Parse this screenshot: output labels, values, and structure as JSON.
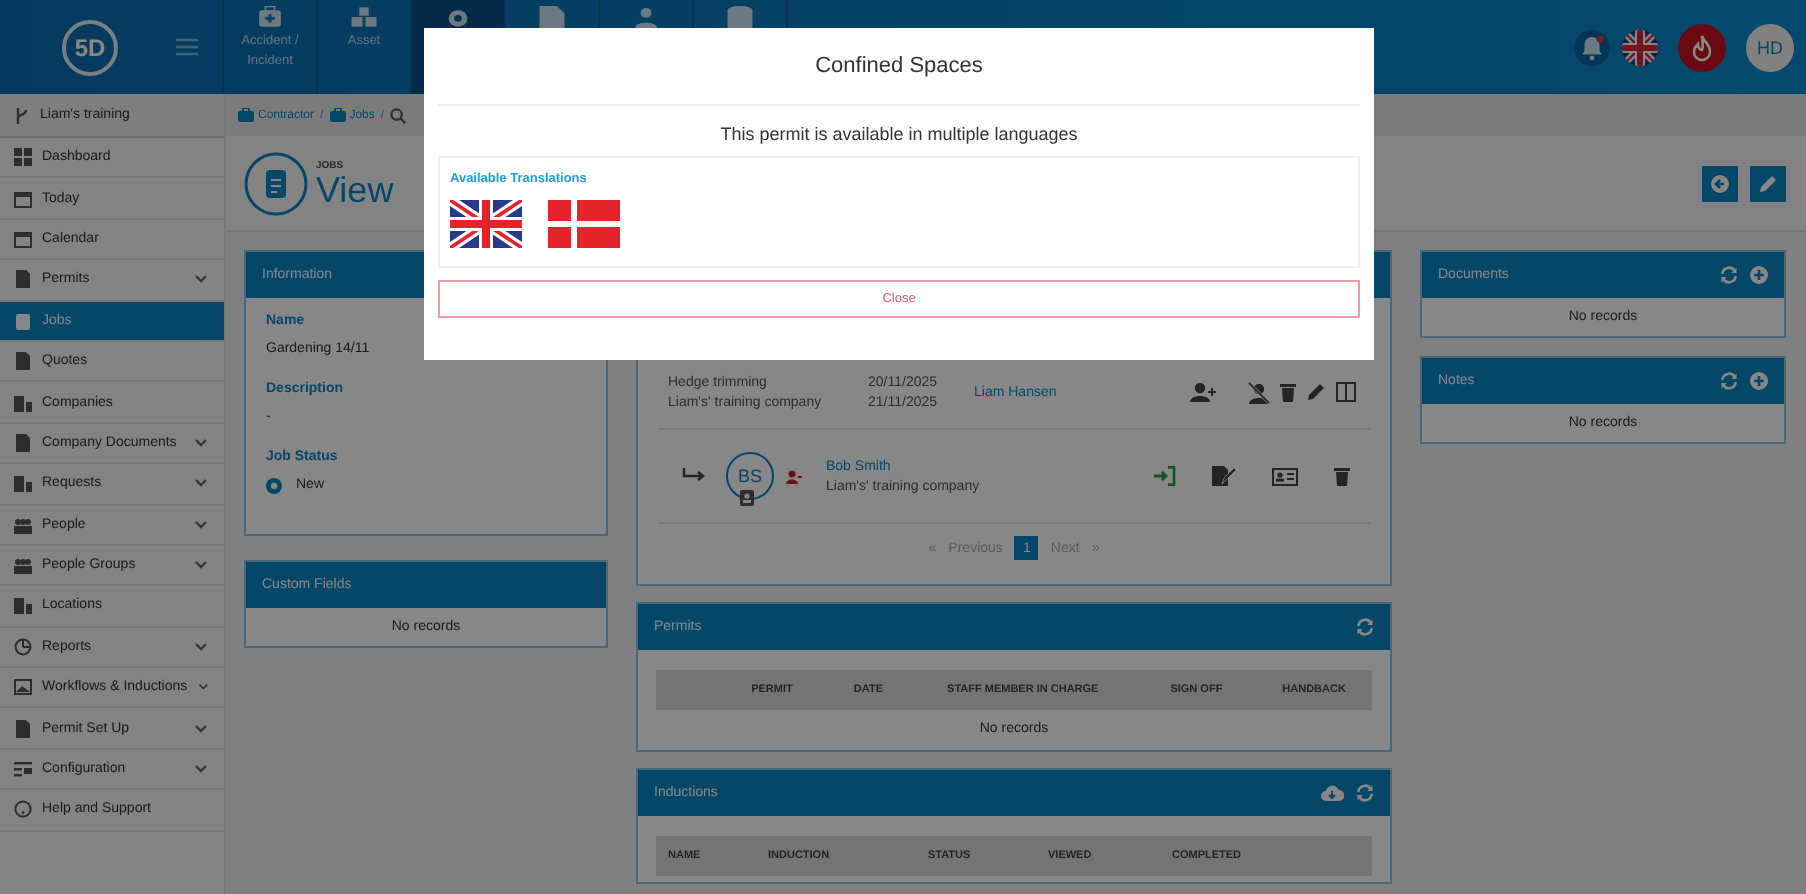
{
  "top_bar": {
    "logo": "5D",
    "modules": [
      {
        "label": "Accident / Incident",
        "selected": false
      },
      {
        "label": "Asset",
        "selected": false
      },
      {
        "selected": true
      },
      {
        "selected": false
      },
      {
        "selected": false
      },
      {
        "selected": false
      }
    ],
    "user": {
      "initials": "HD"
    }
  },
  "sidebar": {
    "account": "Liam's training",
    "items": [
      {
        "label": "Dashboard",
        "selected": false,
        "expandable": false
      },
      {
        "label": "Today",
        "selected": false,
        "expandable": false
      },
      {
        "label": "Calendar",
        "selected": false,
        "expandable": false
      },
      {
        "label": "Permits",
        "selected": false,
        "expandable": true
      },
      {
        "label": "Jobs",
        "selected": true,
        "expandable": false
      },
      {
        "label": "Quotes",
        "selected": false,
        "expandable": false
      },
      {
        "label": "Companies",
        "selected": false,
        "expandable": false
      },
      {
        "label": "Company Documents",
        "selected": false,
        "expandable": true
      },
      {
        "label": "Requests",
        "selected": false,
        "expandable": true
      },
      {
        "label": "People",
        "selected": false,
        "expandable": true
      },
      {
        "label": "People Groups",
        "selected": false,
        "expandable": true
      },
      {
        "label": "Locations",
        "selected": false,
        "expandable": false
      },
      {
        "label": "Reports",
        "selected": false,
        "expandable": true
      },
      {
        "label": "Workflows & Inductions",
        "selected": false,
        "expandable": true
      },
      {
        "label": "Permit Set Up",
        "selected": false,
        "expandable": true
      },
      {
        "label": "Configuration",
        "selected": false,
        "expandable": true
      },
      {
        "label": "Help and Support",
        "selected": false,
        "expandable": false
      }
    ]
  },
  "breadcrumb": [
    {
      "label": "Contractor",
      "separator": "/"
    },
    {
      "label": "Jobs",
      "separator": "/"
    }
  ],
  "page_header": {
    "section": "JOBS",
    "title": "View"
  },
  "information": {
    "title": "Information",
    "fields": [
      {
        "label": "Name",
        "value": "Gardening 14/11"
      },
      {
        "label": "Description",
        "value": "-"
      },
      {
        "label": "Job Status",
        "value": "New"
      }
    ]
  },
  "custom_fields": {
    "title": "Custom Fields",
    "empty": "No records"
  },
  "contractors": {
    "job": {
      "name": "Hedge trimming",
      "company": "Liam's' training company",
      "start": "20/11/2025",
      "end": "21/11/2025",
      "manager": "Liam Hansen"
    },
    "people": [
      {
        "initials": "BS",
        "name": "Bob Smith",
        "company": "Liam's' training company"
      }
    ],
    "pagination": {
      "previous_arrow": "«",
      "previous": "Previous",
      "pages": [
        {
          "label": "1",
          "selected": true
        }
      ],
      "next": "Next",
      "next_arrow": "»"
    }
  },
  "permits": {
    "title": "Permits",
    "columns": [
      "PERMIT",
      "DATE",
      "STAFF MEMBER IN CHARGE",
      "SIGN OFF",
      "HANDBACK"
    ],
    "empty": "No records"
  },
  "inductions": {
    "title": "Inductions",
    "columns": [
      "NAME",
      "INDUCTION",
      "STATUS",
      "VIEWED",
      "COMPLETED"
    ]
  },
  "documents": {
    "title": "Documents",
    "empty": "No records"
  },
  "notes": {
    "title": "Notes",
    "empty": "No records"
  },
  "modal": {
    "title": "Confined Spaces",
    "message": "This permit is available in multiple languages",
    "translations_heading": "Available Translations",
    "close": "Close"
  }
}
